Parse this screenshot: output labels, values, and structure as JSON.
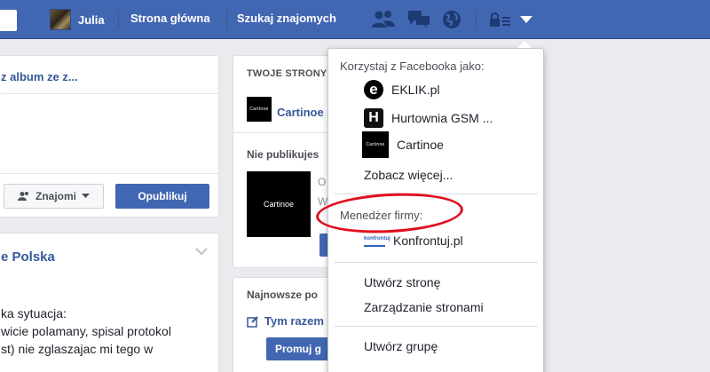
{
  "topbar": {
    "profile_name": "Julia",
    "nav_home": "Strona główna",
    "nav_find_friends": "Szukaj znajomych",
    "icons": [
      "friend-requests-icon",
      "messages-icon",
      "notifications-globe-icon",
      "privacy-lock-icon",
      "account-menu-caret-icon"
    ],
    "brand_color": "#4267b2"
  },
  "composer": {
    "title_fragment": "z album ze z...",
    "audience_label": "Znajomi",
    "publish_label": "Opublikuj"
  },
  "post": {
    "title_fragment": "e Polska",
    "lines": [
      "ka sytuacja:",
      "wicie polamany, spisal protokol",
      "st) nie zglaszajac mi tego w"
    ]
  },
  "pages_panel": {
    "header_fragment": "TWOJE STRONY",
    "page_name_fragment": "Cartinoe",
    "unpublished_fragment": "Nie publikujes",
    "frag_o": "O",
    "frag_w": "W",
    "thumb_text": "Cartinoe"
  },
  "recent_panel": {
    "header_fragment": "Najnowsze po",
    "item_fragment": "Tym razem",
    "promote_fragment": "Promuj g"
  },
  "dropdown": {
    "use_as_header": "Korzystaj z Facebooka jako:",
    "accounts": [
      {
        "name": "EKLIK.pl",
        "icon": "eklik-logo-icon",
        "letter": "e"
      },
      {
        "name": "Hurtownia GSM ...",
        "icon": "hurtownia-logo-icon",
        "letter": "H"
      },
      {
        "name": "Cartinoe",
        "icon": "cartinoe-logo-icon",
        "letter": "Cartinoe"
      }
    ],
    "see_more": "Zobacz więcej...",
    "business_manager_header": "Menedżer firmy:",
    "business_account": {
      "name": "Konfrontuj.pl",
      "icon": "konfrontuj-logo-icon",
      "letter": "konfrontuj"
    },
    "create_page": "Utwórz stronę",
    "manage_pages": "Zarządzanie stronami",
    "create_group": "Utwórz grupę"
  },
  "annotation_color": "#e10d1e"
}
